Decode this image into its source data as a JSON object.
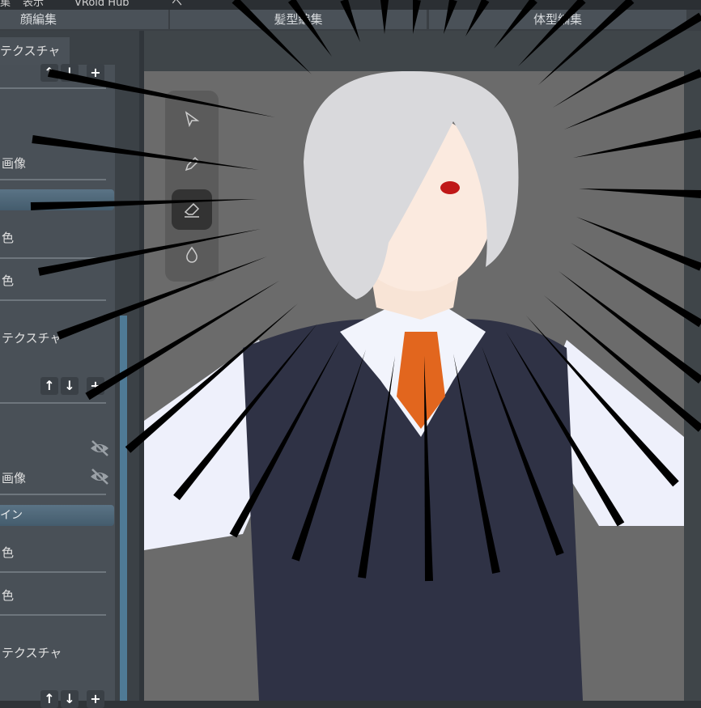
{
  "menu": [
    "集",
    "表示",
    "VRoid Hub",
    "ヘ"
  ],
  "tabs": [
    "顔編集",
    "髪型編集",
    "体型編集"
  ],
  "left_panel": {
    "tab": "テクスチャ",
    "rows": [
      "画像",
      "色",
      "色",
      "テクスチャ",
      "画像",
      "色",
      "色",
      "テクスチャ"
    ],
    "section2": "イン",
    "up": "↑",
    "down": "↓",
    "add": "+"
  },
  "tools": [
    "select-tool",
    "pen-tool",
    "eraser-tool",
    "dropper-tool"
  ]
}
